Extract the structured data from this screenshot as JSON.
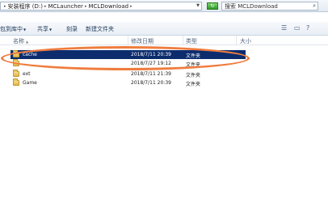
{
  "address": {
    "crumbs": [
      "安装程序 (D:)",
      "MCLauncher",
      "MCLDownload"
    ],
    "search_text": "搜索 MCLDownload"
  },
  "toolbar": {
    "include_in_library": "包到库中",
    "share": "共享",
    "burn": "刻录",
    "new_folder": "新建文件夹"
  },
  "columns": {
    "name": "名称",
    "date": "修改日期",
    "type": "类型",
    "size": "大小"
  },
  "files": [
    {
      "name": "cache",
      "date": "2018/7/11 20:39",
      "type": "文件夹",
      "selected": true
    },
    {
      "name": "",
      "date": "2018/7/27 19:12",
      "type": "文件夹",
      "selected": false
    },
    {
      "name": "ext",
      "date": "2018/7/11 21:39",
      "type": "文件夹",
      "selected": false
    },
    {
      "name": "Game",
      "date": "2018/7/11 20:39",
      "type": "文件夹",
      "selected": false
    }
  ],
  "colors": {
    "selection": "#0c2c6e",
    "annotation": "#ef7c3e"
  }
}
